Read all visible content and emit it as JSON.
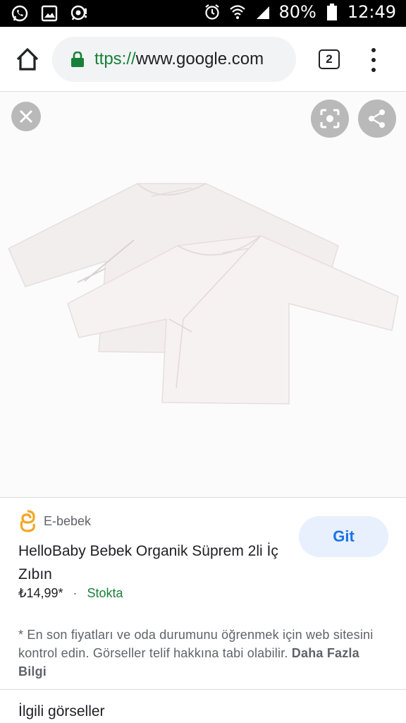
{
  "status_bar": {
    "battery": "80%",
    "time": "12:49"
  },
  "browser": {
    "url_scheme": "ttps://",
    "url_host": "www.google.com",
    "tab_count": "2"
  },
  "result": {
    "source": "E-bebek",
    "title": "HelloBaby Bebek Organik Süprem 2li İç Zıbın",
    "price": "₺14,99*",
    "separator": "·",
    "availability": "Stokta",
    "go_label": "Git",
    "disclaimer": "* En son fiyatları ve oda durumunu öğrenmek için web sitesini kontrol edin. Görseller telif hakkına tabi olabilir.",
    "more_info_link": "Daha Fazla Bilgi"
  },
  "related": {
    "title": "İlgili görseller"
  },
  "colors": {
    "link_green": "#188038",
    "accent_blue": "#1a73e8",
    "button_bg": "#e8f0fe",
    "source_logo": "#f5a623"
  }
}
